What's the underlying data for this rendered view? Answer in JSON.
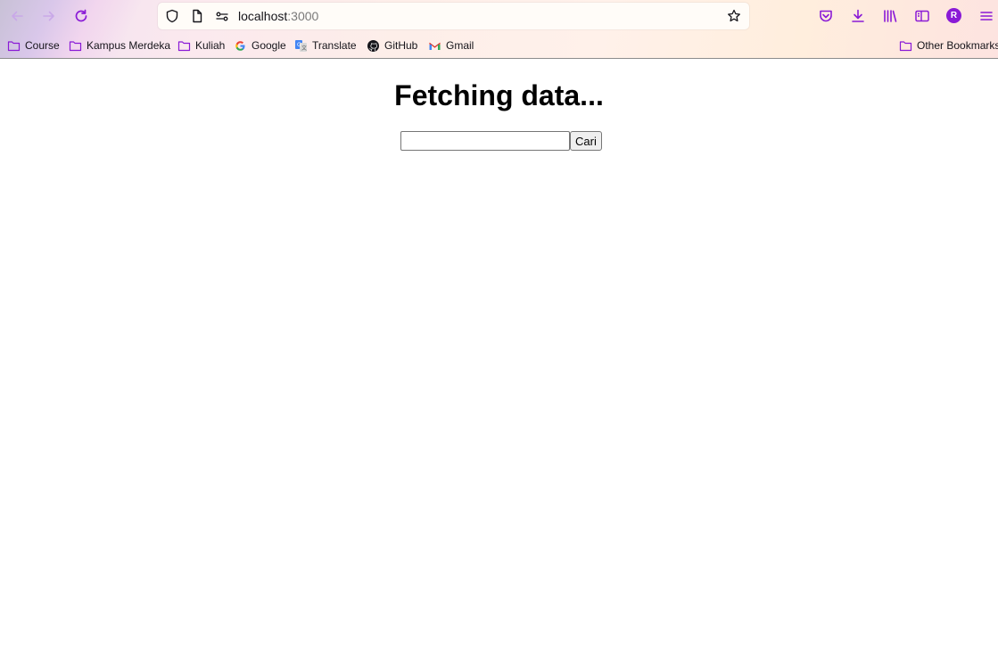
{
  "browser": {
    "url_host": "localhost",
    "url_port": ":3000",
    "profile_initial": "R",
    "accent_color": "#8a1ad6",
    "nav_icons": [
      "back-icon",
      "forward-icon",
      "reload-icon"
    ],
    "toolbar_icons": [
      "pocket-icon",
      "downloads-icon",
      "library-icon",
      "sidebar-icon",
      "account-avatar",
      "menu-icon"
    ]
  },
  "bookmarks": {
    "items": [
      {
        "label": "Course",
        "icon": "folder-icon"
      },
      {
        "label": "Kampus Merdeka",
        "icon": "folder-icon"
      },
      {
        "label": "Kuliah",
        "icon": "folder-icon"
      },
      {
        "label": "Google",
        "icon": "google-icon"
      },
      {
        "label": "Translate",
        "icon": "translate-icon"
      },
      {
        "label": "GitHub",
        "icon": "github-icon"
      },
      {
        "label": "Gmail",
        "icon": "gmail-icon"
      }
    ],
    "other": "Other Bookmarks"
  },
  "page": {
    "title": "Fetching data...",
    "search": {
      "value": "",
      "placeholder": "",
      "button_label": "Cari"
    }
  }
}
